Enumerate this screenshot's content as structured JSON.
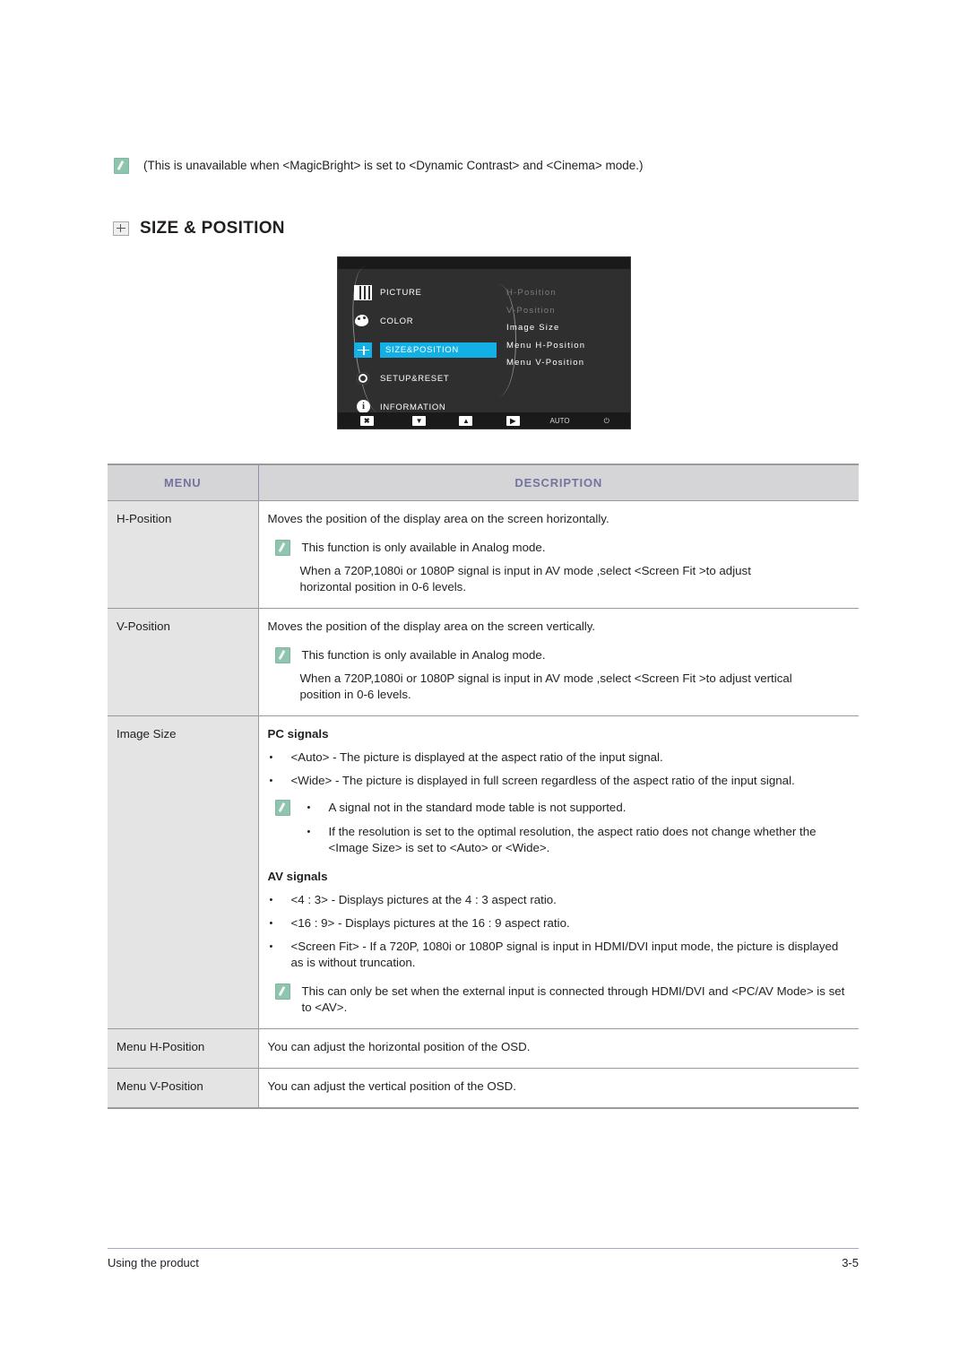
{
  "top_note": {
    "icon": "note-icon",
    "text": "(This is unavailable when <MagicBright> is set to <Dynamic Contrast> and <Cinema> mode.)"
  },
  "section": {
    "icon": "size-position-icon",
    "title": "SIZE & POSITION"
  },
  "osd": {
    "left_menu": [
      {
        "label": "PICTURE",
        "icon": "picture-icon",
        "selected": false
      },
      {
        "label": "COLOR",
        "icon": "color-icon",
        "selected": false
      },
      {
        "label": "SIZE&POSITION",
        "icon": "size-position-icon",
        "selected": true
      },
      {
        "label": "SETUP&RESET",
        "icon": "gear-icon",
        "selected": false
      },
      {
        "label": "INFORMATION",
        "icon": "info-icon",
        "selected": false
      }
    ],
    "submenu": [
      {
        "label": "H-Position",
        "dimmed": true
      },
      {
        "label": "V-Position",
        "dimmed": true
      },
      {
        "label": "Image Size",
        "dimmed": false
      },
      {
        "label": "Menu H-Position",
        "dimmed": false
      },
      {
        "label": "Menu V-Position",
        "dimmed": false
      }
    ],
    "bottom_bar": [
      {
        "label": "✖",
        "icon": "exit-icon",
        "boxed": true
      },
      {
        "label": "▼",
        "icon": "down-arrow-icon",
        "boxed": true
      },
      {
        "label": "▲",
        "icon": "up-arrow-icon",
        "boxed": true
      },
      {
        "label": "▶",
        "icon": "enter-icon",
        "boxed": true
      },
      {
        "label": "AUTO",
        "icon": "auto-icon",
        "boxed": false
      },
      {
        "label": "⏻",
        "icon": "power-icon",
        "boxed": false
      }
    ],
    "accent_color": "#13b0e6"
  },
  "table": {
    "headers": {
      "menu": "MENU",
      "description": "DESCRIPTION"
    },
    "rows": [
      {
        "menu": "H-Position",
        "lead": "Moves the position of the display area on the screen horizontally.",
        "note": "This function is only available in Analog mode.",
        "note_cont_1": "When a 720P,1080i or 1080P signal is input in AV mode ,select <Screen Fit  >to adjust",
        "note_cont_2": "horizontal position in 0-6 levels."
      },
      {
        "menu": "V-Position",
        "lead": "Moves the position of the display area on the screen vertically.",
        "note": "This function is only available in Analog mode.",
        "note_cont_1": "When a 720P,1080i or 1080P signal is input in AV mode ,select <Screen Fit  >to adjust vertical",
        "note_cont_2": "position in 0-6 levels."
      },
      {
        "menu": "Image Size",
        "pc_heading": "PC signals",
        "pc_bullets": [
          "<Auto> - The picture is displayed at the aspect ratio of the input signal.",
          "<Wide> - The picture is displayed in full screen regardless of the aspect ratio of the input signal."
        ],
        "pc_note_bullets": [
          "A signal not in the standard mode table is not supported.",
          "If the resolution is set to the optimal resolution, the aspect ratio does not change whether the <Image Size> is set to <Auto> or <Wide>."
        ],
        "av_heading": "AV signals",
        "av_bullets": [
          "<4 : 3> - Displays pictures at the 4 : 3 aspect ratio.",
          "<16 : 9> - Displays pictures at the 16 : 9 aspect ratio.",
          "<Screen Fit> - If a 720P, 1080i or 1080P signal is input in HDMI/DVI input mode, the picture is displayed as is without truncation."
        ],
        "av_note": "This can only be set when the external input is connected through HDMI/DVI and <PC/AV Mode> is set to <AV>."
      },
      {
        "menu": "Menu H-Position",
        "lead": "You can adjust the horizontal position of the OSD."
      },
      {
        "menu": "Menu V-Position",
        "lead": "You can adjust the vertical position of the OSD."
      }
    ]
  },
  "footer": {
    "left": "Using the product",
    "page": "3-5"
  }
}
